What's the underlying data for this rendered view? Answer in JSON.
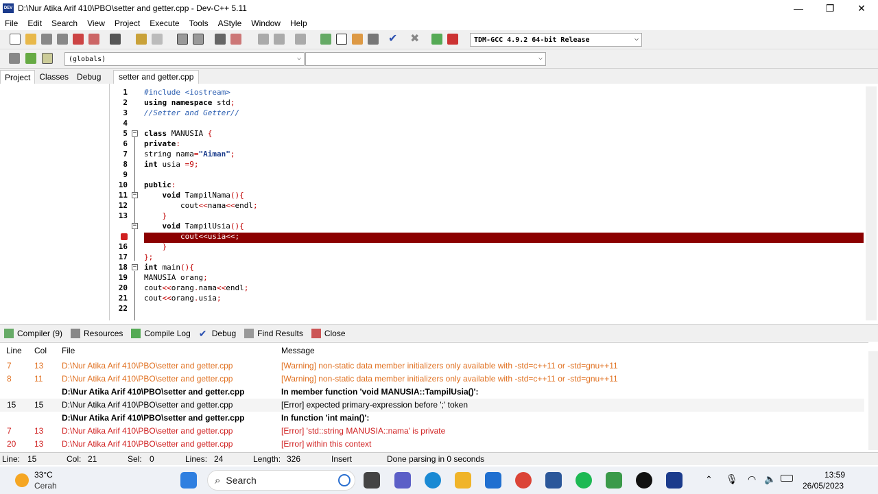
{
  "window": {
    "title": "D:\\Nur Atika Arif 410\\PBO\\setter and getter.cpp - Dev-C++ 5.11"
  },
  "menu": [
    "File",
    "Edit",
    "Search",
    "View",
    "Project",
    "Execute",
    "Tools",
    "AStyle",
    "Window",
    "Help"
  ],
  "toolbar": {
    "compiler_select": "TDM-GCC 4.9.2 64-bit Release",
    "scope_select": "(globals)",
    "member_select": ""
  },
  "left_tabs": [
    "Project",
    "Classes",
    "Debug"
  ],
  "editor": {
    "tab": "setter and getter.cpp",
    "line_numbers": [
      "1",
      "2",
      "3",
      "4",
      "5",
      "6",
      "7",
      "8",
      "9",
      "10",
      "11",
      "12",
      "13",
      "",
      "16",
      "17",
      "18",
      "19",
      "20",
      "21",
      "22"
    ],
    "error_line_number": "15"
  },
  "bottom_tabs": [
    "Compiler (9)",
    "Resources",
    "Compile Log",
    "Debug",
    "Find Results",
    "Close"
  ],
  "messages": {
    "headers": {
      "line": "Line",
      "col": "Col",
      "file": "File",
      "message": "Message"
    },
    "rows": [
      {
        "line": "7",
        "col": "13",
        "file": "D:\\Nur Atika Arif 410\\PBO\\setter and getter.cpp",
        "message": "[Warning] non-static data member initializers only available with -std=c++11 or -std=gnu++11"
      },
      {
        "line": "8",
        "col": "11",
        "file": "D:\\Nur Atika Arif 410\\PBO\\setter and getter.cpp",
        "message": "[Warning] non-static data member initializers only available with -std=c++11 or -std=gnu++11"
      },
      {
        "line": "",
        "col": "",
        "file": "D:\\Nur Atika Arif 410\\PBO\\setter and getter.cpp",
        "message": "In member function 'void MANUSIA::TampilUsia()':"
      },
      {
        "line": "15",
        "col": "15",
        "file": "D:\\Nur Atika Arif 410\\PBO\\setter and getter.cpp",
        "message": "[Error] expected primary-expression before ';' token"
      },
      {
        "line": "",
        "col": "",
        "file": "D:\\Nur Atika Arif 410\\PBO\\setter and getter.cpp",
        "message": "In function 'int main()':"
      },
      {
        "line": "7",
        "col": "13",
        "file": "D:\\Nur Atika Arif 410\\PBO\\setter and getter.cpp",
        "message": "[Error] 'std::string MANUSIA::nama' is private"
      },
      {
        "line": "20",
        "col": "13",
        "file": "D:\\Nur Atika Arif 410\\PBO\\setter and getter.cpp",
        "message": "[Error] within this context"
      }
    ]
  },
  "status": {
    "line_label": "Line:",
    "line": "15",
    "col_label": "Col:",
    "col": "21",
    "sel_label": "Sel:",
    "sel": "0",
    "lines_label": "Lines:",
    "lines": "24",
    "length_label": "Length:",
    "length": "326",
    "mode": "Insert",
    "message": "Done parsing in 0 seconds"
  },
  "taskbar": {
    "temp": "33°C",
    "weather": "Cerah",
    "search": "Search",
    "time": "13:59",
    "date": "26/05/2023"
  }
}
